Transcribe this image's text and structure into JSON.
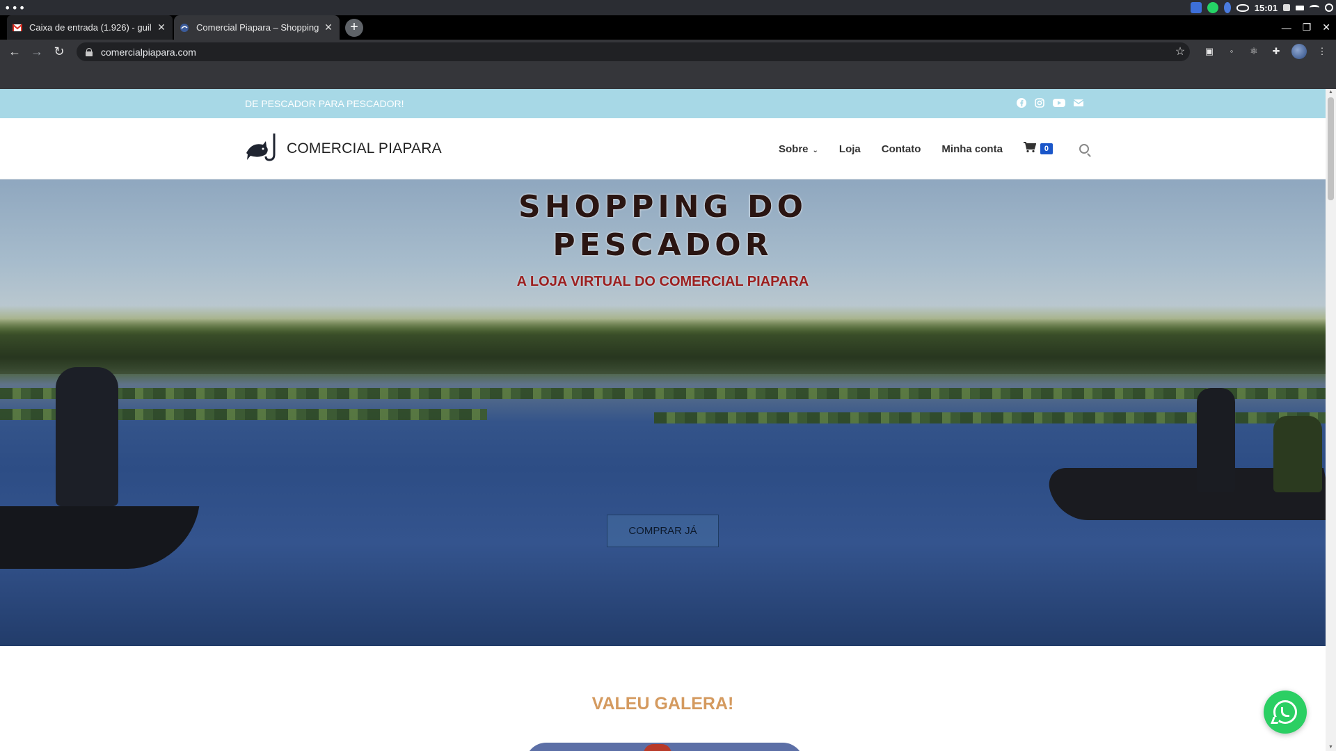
{
  "os": {
    "time": "15:01",
    "menu_dots": "•••"
  },
  "browser": {
    "tabs": [
      {
        "label": "Caixa de entrada (1.926) - guil",
        "favicon": "gmail-icon",
        "active": false
      },
      {
        "label": "Comercial Piapara – Shopping",
        "favicon": "piapara-favicon-icon",
        "active": true
      }
    ],
    "new_tab_label": "+",
    "url": "comercialpiapara.com"
  },
  "site": {
    "topbar": {
      "tagline": "DE PESCADOR PARA PESCADOR!",
      "social_icons": [
        "facebook-icon",
        "instagram-icon",
        "youtube-icon",
        "email-icon"
      ]
    },
    "logo_text": "COMERCIAL PIAPARA",
    "nav": {
      "sobre": "Sobre",
      "loja": "Loja",
      "contato": "Contato",
      "minha_conta": "Minha conta",
      "cart_count": "0"
    },
    "hero": {
      "title_line1": "SHOPPING DO",
      "title_line2": "PESCADOR",
      "subtitle": "A LOJA VIRTUAL DO COMERCIAL PIAPARA",
      "cta": "COMPRAR JÁ"
    },
    "section_title": "VALEU GALERA!"
  },
  "colors": {
    "topbar_bg": "#a7d8e6",
    "subtitle_red": "#9b2020",
    "section_title": "#d49a5f",
    "cart_badge": "#1a56c9",
    "whatsapp_green": "#2bcf63"
  }
}
